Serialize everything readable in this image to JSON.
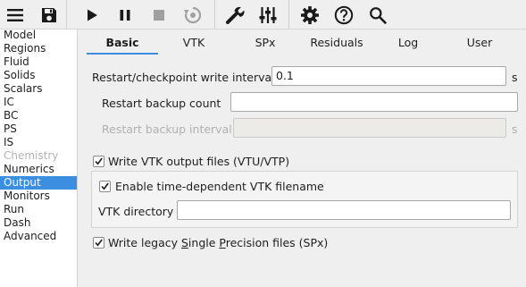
{
  "toolbar": {
    "icons": [
      "menu-icon",
      "save-icon",
      "run-icon",
      "pause-icon",
      "stop-icon",
      "reset-icon",
      "build-icon",
      "parameters-icon",
      "settings-icon",
      "help-icon",
      "search-icon"
    ]
  },
  "sidebar": {
    "items": [
      {
        "label": "Model",
        "state": "normal"
      },
      {
        "label": "Regions",
        "state": "normal"
      },
      {
        "label": "Fluid",
        "state": "normal"
      },
      {
        "label": "Solids",
        "state": "normal"
      },
      {
        "label": "Scalars",
        "state": "normal"
      },
      {
        "label": "IC",
        "state": "normal"
      },
      {
        "label": "BC",
        "state": "normal"
      },
      {
        "label": "PS",
        "state": "normal"
      },
      {
        "label": "IS",
        "state": "normal"
      },
      {
        "label": "Chemistry",
        "state": "disabled"
      },
      {
        "label": "Numerics",
        "state": "normal"
      },
      {
        "label": "Output",
        "state": "selected"
      },
      {
        "label": "Monitors",
        "state": "normal"
      },
      {
        "label": "Run",
        "state": "normal"
      },
      {
        "label": "Dash",
        "state": "normal"
      },
      {
        "label": "Advanced",
        "state": "normal"
      }
    ]
  },
  "tabs": [
    {
      "label": "Basic",
      "active": true
    },
    {
      "label": "VTK",
      "active": false
    },
    {
      "label": "SPx",
      "active": false
    },
    {
      "label": "Residuals",
      "active": false
    },
    {
      "label": "Log",
      "active": false
    },
    {
      "label": "User",
      "active": false
    }
  ],
  "form": {
    "restart_interval": {
      "label": "Restart/checkpoint write interval",
      "value": "0.1",
      "unit": "s"
    },
    "backup_count": {
      "label": "Restart backup count",
      "value": ""
    },
    "backup_interval": {
      "label": "Restart backup interval",
      "value": "",
      "unit": "s",
      "disabled": true
    },
    "write_vtk": {
      "label": "Write VTK output files (VTU/VTP)",
      "checked": true
    },
    "time_dependent_vtk": {
      "label": "Enable time-dependent VTK filename",
      "checked": true
    },
    "vtk_directory": {
      "label": "VTK directory",
      "value": ""
    },
    "write_spx": {
      "label_pre": "Write legacy ",
      "label_s": "S",
      "label_mid": "ingle ",
      "label_p": "P",
      "label_post": "recision files (SPx)",
      "checked": true
    }
  },
  "colors": {
    "accent": "#3b8ee0",
    "selected_text": "#ffffff",
    "disabled_text": "#b4b4b4"
  }
}
